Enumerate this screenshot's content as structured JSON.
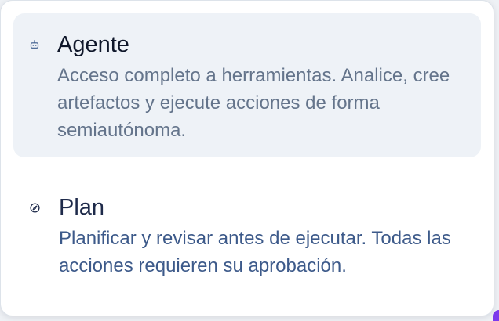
{
  "menu": {
    "options": [
      {
        "icon": "robot-icon",
        "title": "Agente",
        "description": "Acceso completo a herramientas. Analice, cree artefactos y ejecute acciones de forma semiautónoma.",
        "selected": true
      },
      {
        "icon": "compass-icon",
        "title": "Plan",
        "description": "Planificar y revisar antes de ejecutar. Todas las acciones requieren su aprobación.",
        "selected": false
      }
    ]
  },
  "colors": {
    "selected_background": "#eef2f7",
    "title_text": "#0f172a",
    "description_text": "#64748b",
    "plan_text": "#3d5a8a"
  }
}
